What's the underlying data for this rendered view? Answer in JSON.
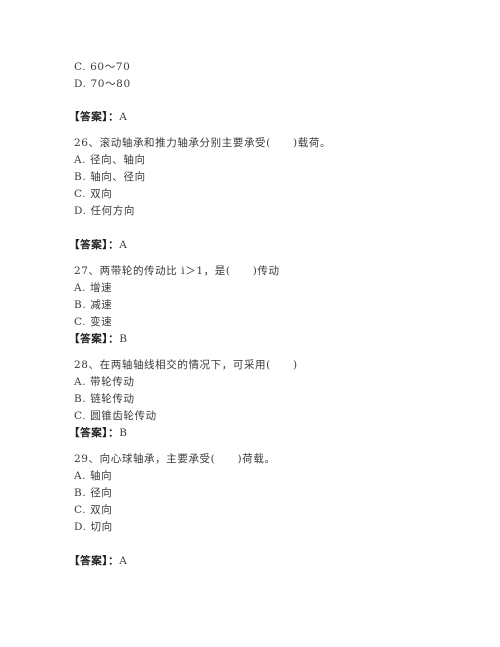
{
  "prev_question": {
    "options": [
      "C. 60～70",
      "D. 70～80"
    ],
    "answer_label": "【答案】：",
    "answer": "A"
  },
  "questions": [
    {
      "stem": "26、滚动轴承和推力轴承分别主要承受(　　)载荷。",
      "options": [
        "A. 径向、轴向",
        "B. 轴向、径向",
        "C. 双向",
        "D. 任何方向"
      ],
      "answer_label": "【答案】：",
      "answer": "A"
    },
    {
      "stem": "27、两带轮的传动比 i＞1，是(　　)传动",
      "options": [
        "A. 增速",
        "B. 减速",
        "C. 变速"
      ],
      "answer_label": "【答案】：",
      "answer": "B"
    },
    {
      "stem": "28、在两轴轴线相交的情况下，可采用(　　)",
      "options": [
        "A. 带轮传动",
        "B. 链轮传动",
        "C. 圆锥齿轮传动"
      ],
      "answer_label": "【答案】：",
      "answer": "B"
    },
    {
      "stem": "29、向心球轴承，主要承受(　　)荷载。",
      "options": [
        "A. 轴向",
        "B. 径向",
        "C. 双向",
        "D. 切向"
      ],
      "answer_label": "【答案】：",
      "answer": "A"
    }
  ]
}
